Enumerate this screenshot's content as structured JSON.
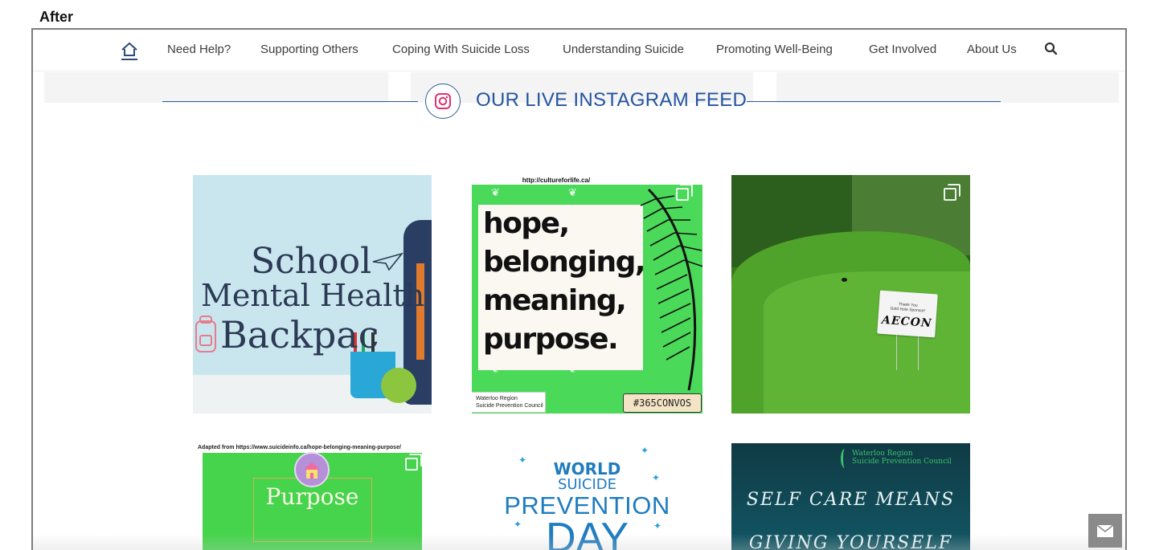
{
  "label": "After",
  "nav": {
    "items": [
      "Need Help?",
      "Supporting Others",
      "Coping With Suicide Loss",
      "Understanding Suicide",
      "Promoting Well-Being",
      "Get Involved",
      "About Us"
    ],
    "home_icon": "home-icon",
    "search_icon": "search-icon"
  },
  "feed": {
    "title": "OUR LIVE INSTAGRAM FEED",
    "icon": "instagram-icon",
    "accent": "#2454a0"
  },
  "posts": {
    "p1": {
      "lines": [
        "School",
        "Mental Health",
        "Backpac"
      ]
    },
    "p2": {
      "url": "http://cultureforlife.ca/",
      "lines": [
        "hope,",
        "belonging,",
        "meaning,",
        "purpose."
      ],
      "org": [
        "Waterloo Region",
        "Suicide Prevention Council"
      ],
      "tag": "#365CONVOS"
    },
    "p3": {
      "sign_top": [
        "Thank You",
        "Gold Hole Sponsor!"
      ],
      "sign_brand": "AECON"
    },
    "p4": {
      "url": "Adapted from https://www.suicideinfo.ca/hope-belonging-meaning-purpose/",
      "word": "Purpose"
    },
    "p5": {
      "lines": [
        "WORLD",
        "SUICIDE",
        "PREVENTION",
        "DAY"
      ]
    },
    "p6": {
      "org": [
        "Waterloo Region",
        "Suicide Prevention Council"
      ],
      "lines": [
        "SELF CARE MEANS",
        "GIVING YOURSELF"
      ]
    }
  },
  "contact_icon": "envelope-icon",
  "colors": {
    "green": "#4ad959",
    "navy": "#2d5a9e",
    "gray_button": "#8a8a8a"
  }
}
